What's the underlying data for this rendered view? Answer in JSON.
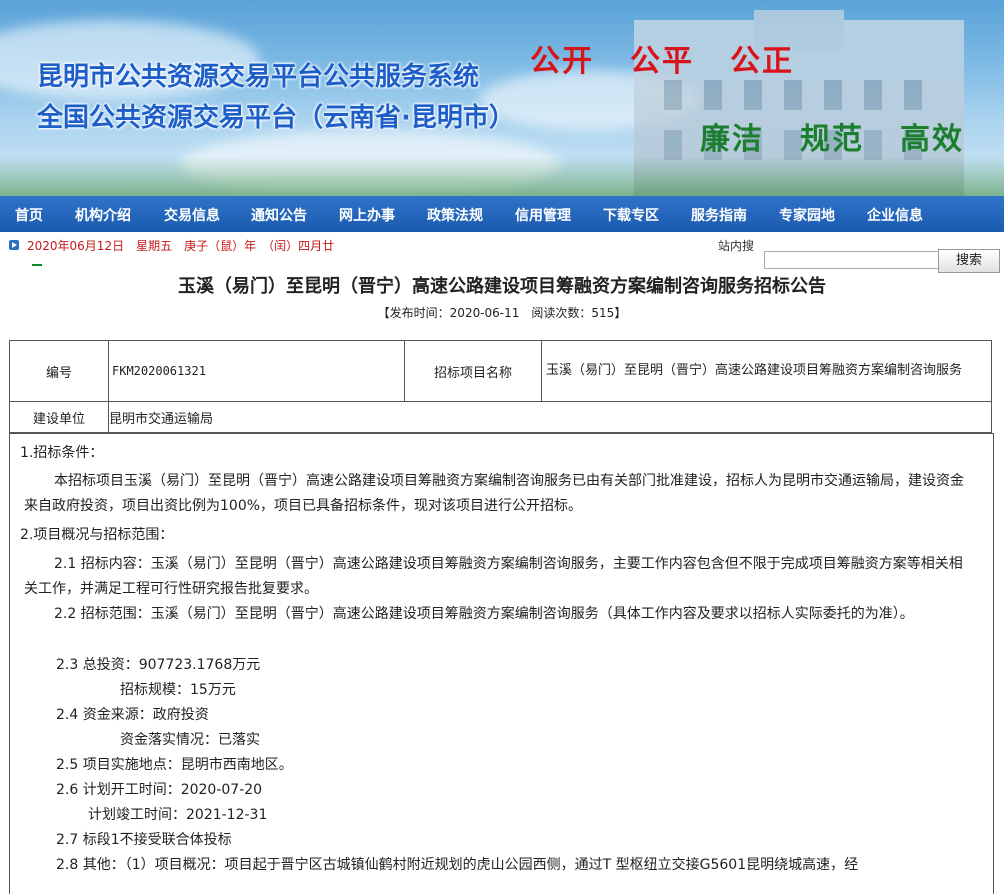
{
  "banner": {
    "title_line1": "昆明市公共资源交易平台公共服务系统",
    "title_line2": "全国公共资源交易平台（云南省·昆明市）",
    "slogan_top": [
      "公开",
      "公平",
      "公正"
    ],
    "slogan_bottom": [
      "廉洁",
      "规范",
      "高效"
    ]
  },
  "nav": [
    "首页",
    "机构介绍",
    "交易信息",
    "通知公告",
    "网上办事",
    "政策法规",
    "信用管理",
    "下载专区",
    "服务指南",
    "专家园地",
    "企业信息"
  ],
  "datebar": {
    "date_text": "2020年06月12日　星期五　庚子（鼠）年　（闰）四月廿",
    "search_label": "站内搜",
    "search_value": "",
    "search_button": "搜索"
  },
  "article": {
    "title": "玉溪（易门）至昆明（晋宁）高速公路建设项目筹融资方案编制咨询服务招标公告",
    "meta": "【发布时间：2020-06-11　阅读次数：515】"
  },
  "info_table": {
    "code_label": "编号",
    "code_value": "FKM2020061321",
    "project_label": "招标项目名称",
    "project_value": "玉溪（易门）至昆明（晋宁）高速公路建设项目筹融资方案编制咨询服务",
    "unit_label": "建设单位",
    "unit_value": "昆明市交通运输局"
  },
  "content": {
    "h1": "1.招标条件：",
    "p1": "本招标项目玉溪（易门）至昆明（晋宁）高速公路建设项目筹融资方案编制咨询服务已由有关部门批准建设，招标人为昆明市交通运输局，建设资金来自政府投资，项目出资比例为100%，项目已具备招标条件，现对该项目进行公开招标。",
    "h2": "2.项目概况与招标范围：",
    "p21": "2.1 招标内容：玉溪（易门）至昆明（晋宁）高速公路建设项目筹融资方案编制咨询服务，主要工作内容包含但不限于完成项目筹融资方案等相关相关工作，并满足工程可行性研究报告批复要求。",
    "p22": "2.2 招标范围：玉溪（易门）至昆明（晋宁）高速公路建设项目筹融资方案编制咨询服务（具体工作内容及要求以招标人实际委托的为准）。",
    "l23a": "2.3 总投资：907723.1768万元",
    "l23b": "招标规模：15万元",
    "l24a": "2.4 资金来源：政府投资",
    "l24b": "资金落实情况：已落实",
    "l25": "2.5 项目实施地点：昆明市西南地区。",
    "l26a": "2.6 计划开工时间：2020-07-20",
    "l26b": "计划竣工时间：2021-12-31",
    "l27": "2.7 标段1不接受联合体投标",
    "l28": "2.8 其他：（1）项目概况：项目起于晋宁区古城镇仙鹤村附近规划的虎山公园西侧，通过T 型枢纽立交接G5601昆明绕城高速，经"
  }
}
